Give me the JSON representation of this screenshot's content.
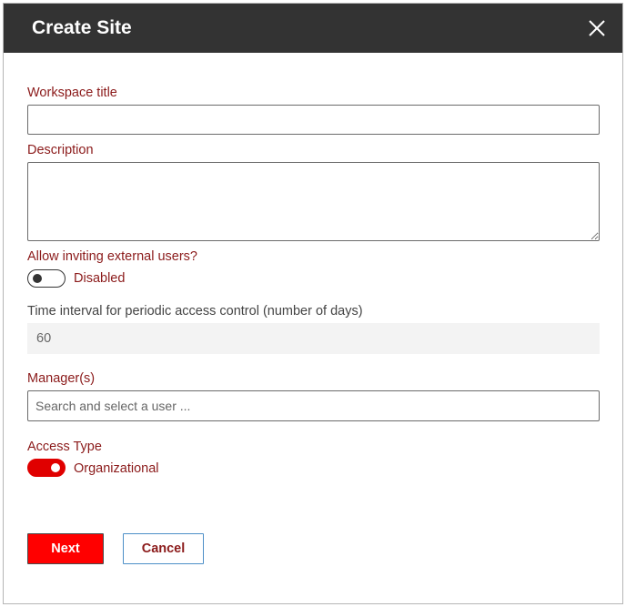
{
  "dialog": {
    "title": "Create Site",
    "close_icon": "close-icon"
  },
  "form": {
    "workspace_title": {
      "label": "Workspace title",
      "value": ""
    },
    "description": {
      "label": "Description",
      "value": ""
    },
    "external_users": {
      "label": "Allow inviting external users?",
      "state": "Disabled",
      "enabled": false
    },
    "access_interval": {
      "label": "Time interval for periodic access control (number of days)",
      "value": "60"
    },
    "managers": {
      "label": "Manager(s)",
      "placeholder": "Search and select a user ..."
    },
    "access_type": {
      "label": "Access Type",
      "state": "Organizational",
      "enabled": true
    }
  },
  "buttons": {
    "next": "Next",
    "cancel": "Cancel"
  },
  "colors": {
    "header_bg": "#333333",
    "label_red": "#8b1a1a",
    "accent_red": "#ff0000",
    "cancel_border": "#4d8fc7"
  }
}
